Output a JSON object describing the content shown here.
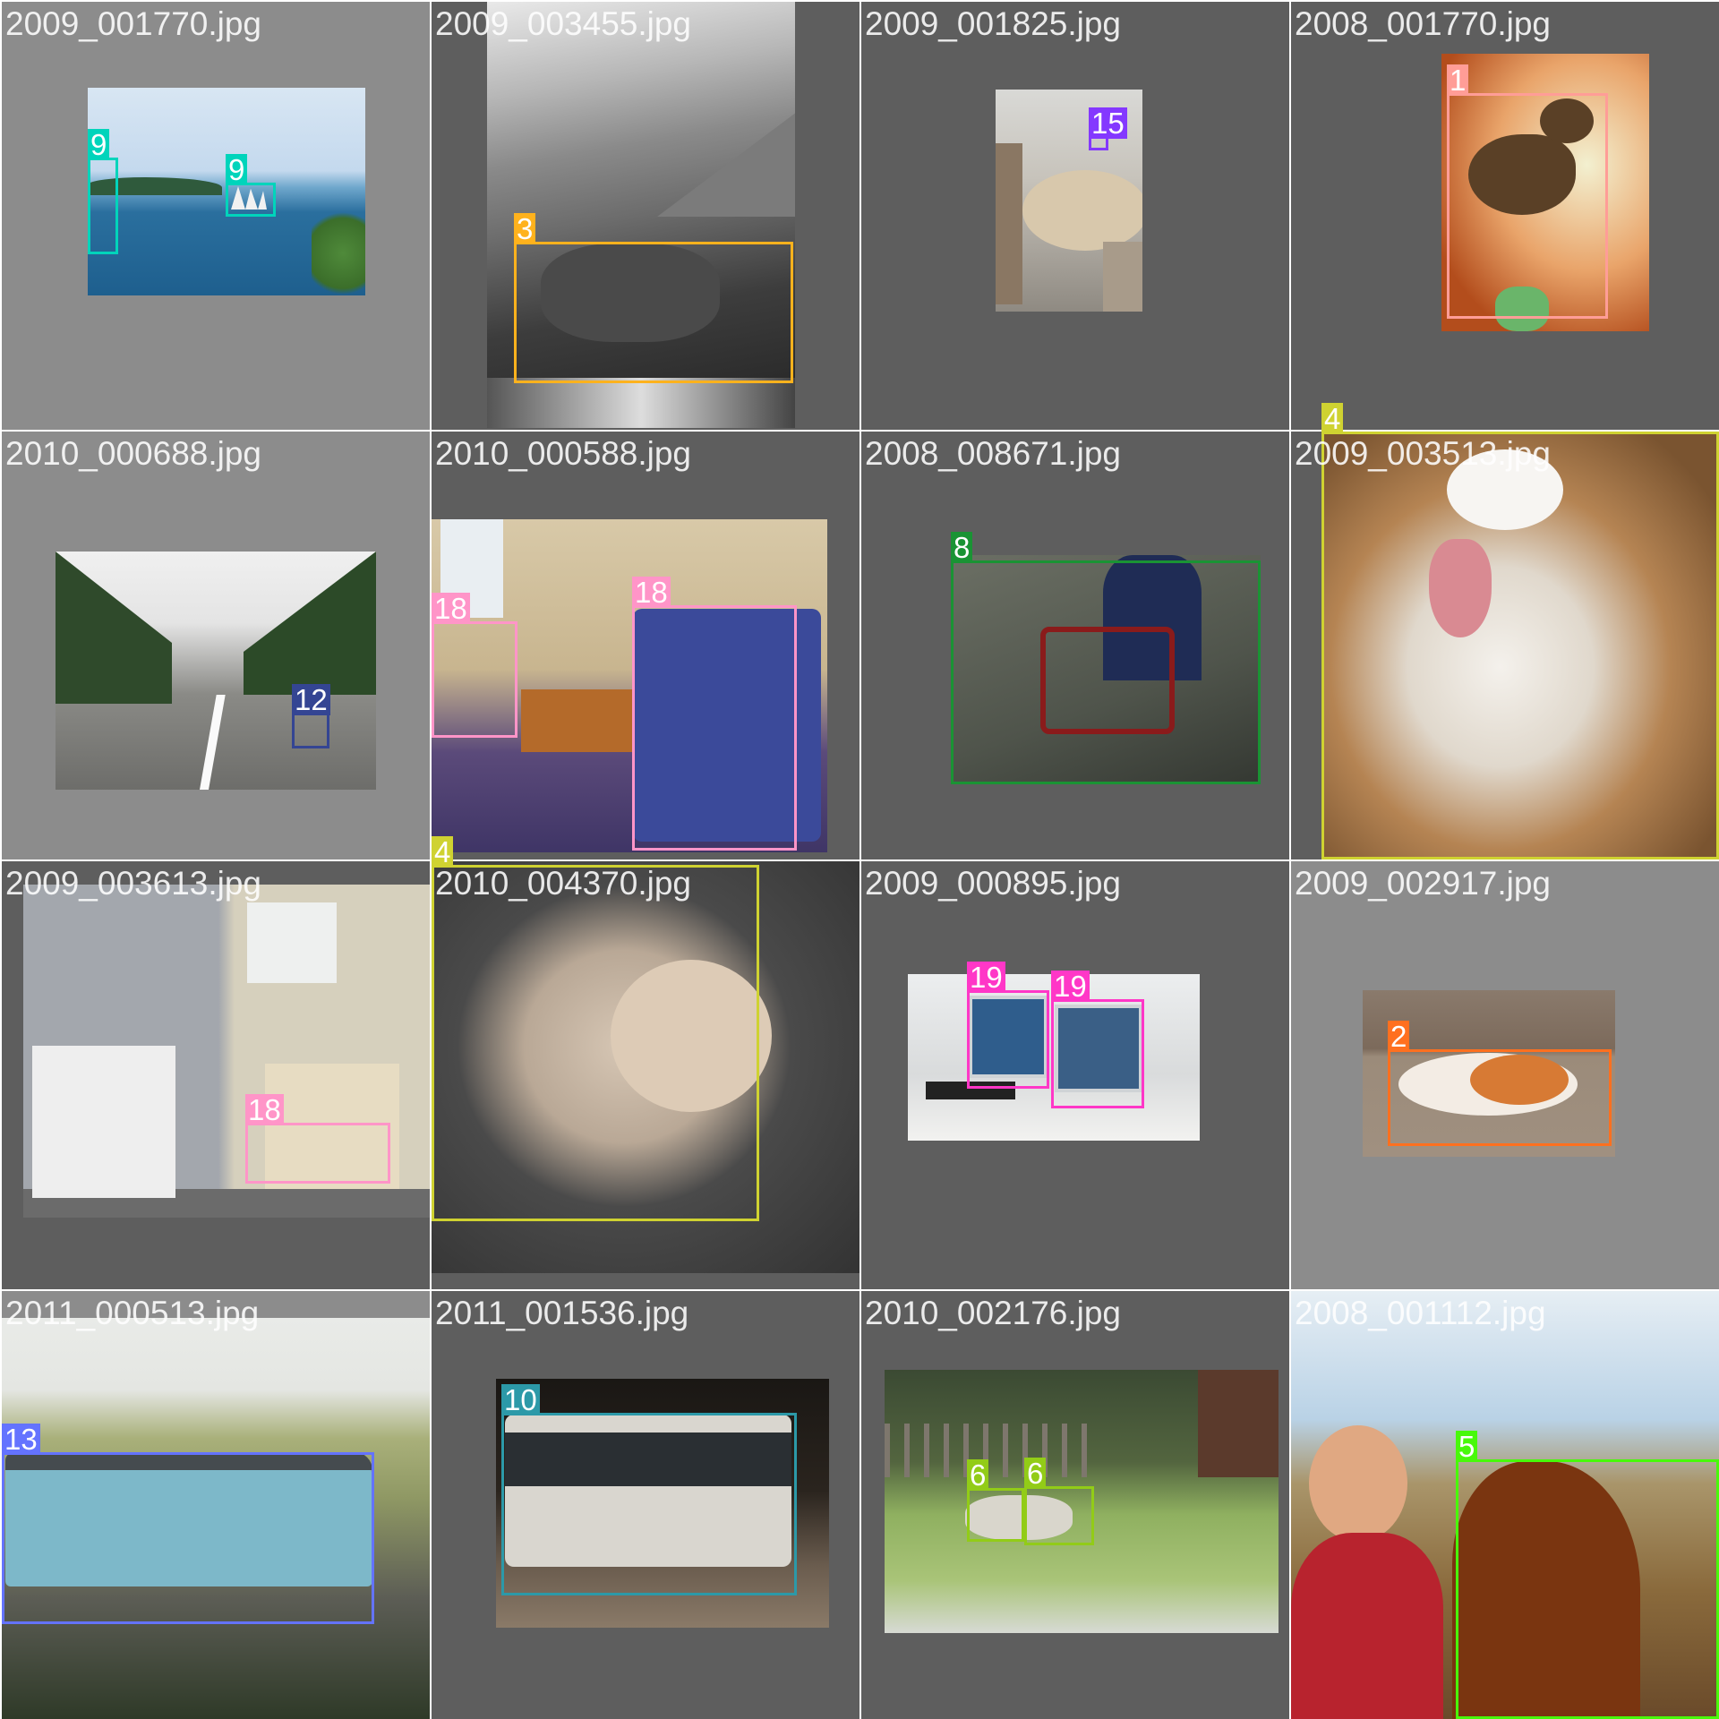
{
  "colors": {
    "grey_light": "#8c8c8c",
    "grey_dark": "#5e5e5e",
    "class_1": "#ff9d97",
    "class_2": "#ff701f",
    "class_3": "#ffb21d",
    "class_4": "#cfd231",
    "class_5": "#48f90a",
    "class_6": "#92cc17",
    "class_8": "#1a9334",
    "class_9": "#00d4bb",
    "class_10": "#2c99a8",
    "class_12": "#344593",
    "class_13": "#6473ff",
    "class_15": "#8438ff",
    "class_18": "#ff95c8",
    "class_19": "#ff37c7"
  },
  "tiles": [
    {
      "filename": "2009_001770.jpg",
      "boxes": [
        {
          "label": "9"
        },
        {
          "label": "9"
        }
      ]
    },
    {
      "filename": "2009_003455.jpg",
      "boxes": [
        {
          "label": "3"
        }
      ]
    },
    {
      "filename": "2009_001825.jpg",
      "boxes": [
        {
          "label": "15"
        }
      ]
    },
    {
      "filename": "2008_001770.jpg",
      "boxes": [
        {
          "label": "1"
        }
      ]
    },
    {
      "filename": "2010_000688.jpg",
      "boxes": [
        {
          "label": "12"
        }
      ]
    },
    {
      "filename": "2010_000588.jpg",
      "boxes": [
        {
          "label": "18"
        },
        {
          "label": "18"
        }
      ]
    },
    {
      "filename": "2008_008671.jpg",
      "boxes": [
        {
          "label": "8"
        }
      ]
    },
    {
      "filename": "2009_003513.jpg",
      "boxes": [
        {
          "label": "4"
        }
      ]
    },
    {
      "filename": "2009_003613.jpg",
      "boxes": [
        {
          "label": "18"
        }
      ]
    },
    {
      "filename": "2010_004370.jpg",
      "boxes": [
        {
          "label": "4"
        }
      ]
    },
    {
      "filename": "2009_000895.jpg",
      "boxes": [
        {
          "label": "19"
        },
        {
          "label": "19"
        }
      ]
    },
    {
      "filename": "2009_002917.jpg",
      "boxes": [
        {
          "label": "2"
        }
      ]
    },
    {
      "filename": "2011_000513.jpg",
      "boxes": [
        {
          "label": "13"
        }
      ]
    },
    {
      "filename": "2011_001536.jpg",
      "boxes": [
        {
          "label": "10"
        }
      ]
    },
    {
      "filename": "2010_002176.jpg",
      "boxes": [
        {
          "label": "6"
        },
        {
          "label": "6"
        }
      ]
    },
    {
      "filename": "2008_001112.jpg",
      "boxes": [
        {
          "label": "5"
        }
      ]
    }
  ]
}
